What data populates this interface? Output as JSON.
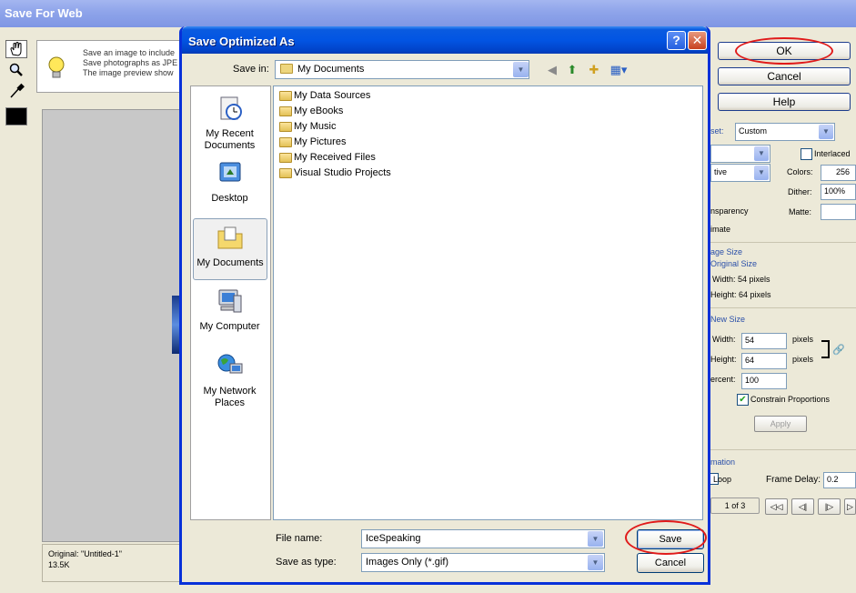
{
  "background_window": {
    "title": "Save For Web",
    "tip_text": [
      "Save an image to include",
      "Save photographs as JPE",
      "The image preview show"
    ],
    "status": {
      "original": "Original: \"Untitled-1\"",
      "size": "13.5K"
    },
    "buttons": {
      "ok": "OK",
      "cancel": "Cancel",
      "help": "Help"
    },
    "settings": {
      "preset_label": "set:",
      "preset_value": "Custom",
      "interlaced_label": "Interlaced",
      "algorithm_value": "tive",
      "colors_label": "Colors:",
      "colors_value": "256",
      "dither_label": "Dither:",
      "dither_value": "100%",
      "transparency_label": "nsparency",
      "matte_label": "Matte:",
      "imate_label": "imate"
    },
    "image_size": {
      "section_label": "age Size",
      "original_size_label": "Original Size",
      "orig_width": "Width: 54 pixels",
      "orig_height": "Height: 64 pixels",
      "new_size_label": "New Size",
      "width_label": "Width:",
      "width_value": "54",
      "height_label": "Height:",
      "height_value": "64",
      "percent_label": "ercent:",
      "percent_value": "100",
      "pixels_label": "pixels",
      "constrain_label": "Constrain Proportions",
      "apply_label": "Apply"
    },
    "animation": {
      "section_label": "mation",
      "loop_label": "Loop",
      "frame_delay_label": "Frame Delay:",
      "frame_delay_value": "0.2",
      "frame_counter": "1 of 3",
      "controls": [
        "◁◁",
        "◁|",
        "|▷",
        "▷"
      ]
    }
  },
  "dialog": {
    "title": "Save Optimized As",
    "help_glyph": "?",
    "close_glyph": "✕",
    "save_in_label": "Save in:",
    "save_in_value": "My Documents",
    "places": [
      {
        "label": "My Recent Documents",
        "icon": "recent-documents-icon"
      },
      {
        "label": "Desktop",
        "icon": "desktop-icon"
      },
      {
        "label": "My Documents",
        "icon": "my-documents-icon"
      },
      {
        "label": "My Computer",
        "icon": "my-computer-icon"
      },
      {
        "label": "My Network Places",
        "icon": "network-places-icon"
      }
    ],
    "files": [
      "My Data Sources",
      "My eBooks",
      "My Music",
      "My Pictures",
      "My Received Files",
      "Visual Studio Projects"
    ],
    "file_name_label": "File name:",
    "file_name_value": "IceSpeaking",
    "save_as_type_label": "Save as type:",
    "save_as_type_value": "Images Only (*.gif)",
    "save_button": "Save",
    "cancel_button": "Cancel"
  },
  "colors": {
    "annotation_circle": "#e01a1a",
    "dialog_title_bar": "#0255e3",
    "window_face": "#ece9d8"
  }
}
